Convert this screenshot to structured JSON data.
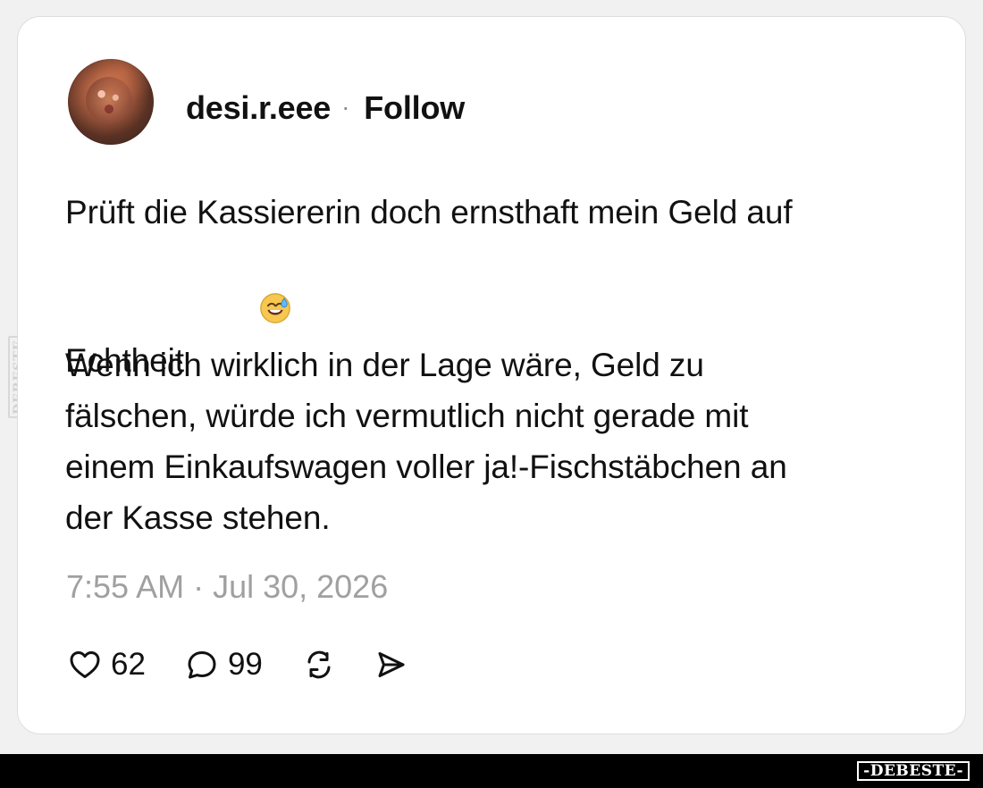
{
  "post": {
    "username": "desi.r.eee",
    "separator": "·",
    "follow_label": "Follow",
    "text_lines": [
      "Prüft die Kassiererin doch ernsthaft mein Geld auf",
      "Echtheit",
      "",
      "Wenn ich wirklich in der Lage wäre, Geld zu",
      "fälschen, würde ich vermutlich nicht gerade mit",
      "einem Einkaufswagen voller ja!-Fischstäbchen an",
      "der Kasse stehen."
    ],
    "emoji": "😅",
    "timestamp": "7:55 AM · Jul 30, 2026",
    "likes": "62",
    "comments": "99"
  },
  "watermarks": {
    "side": "DEBESTE",
    "bottom": "-DEBESTE-"
  },
  "colors": {
    "background": "#f1f1f1",
    "card": "#ffffff",
    "text": "#111111",
    "muted": "#a0a0a0",
    "bar": "#000000"
  },
  "icons": {
    "like": "heart-icon",
    "comment": "comment-icon",
    "repost": "repost-icon",
    "share": "share-icon",
    "emoji": "smiling-face-with-sweat-icon"
  }
}
